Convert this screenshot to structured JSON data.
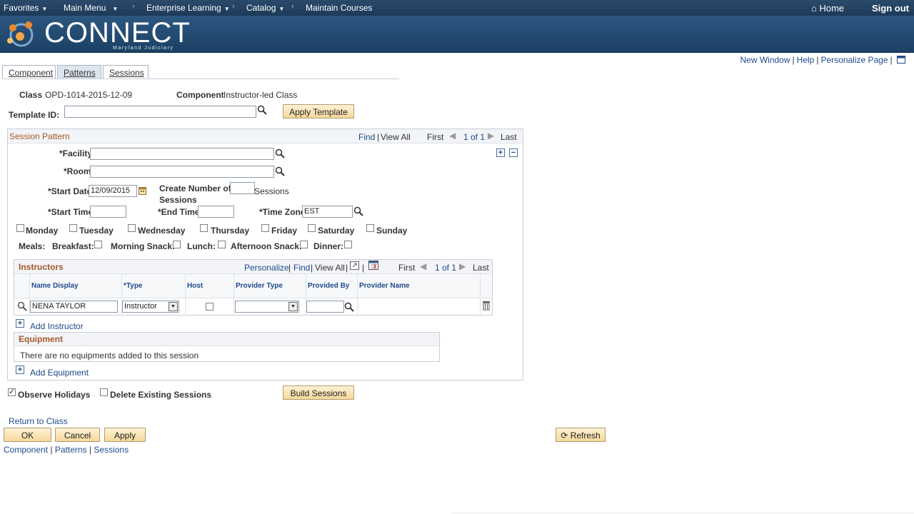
{
  "nav": {
    "favorites": "Favorites",
    "main_menu": "Main Menu",
    "enterprise_learning": "Enterprise Learning",
    "catalog": "Catalog",
    "maintain_courses": "Maintain Courses",
    "home": "Home",
    "sign_out": "Sign out"
  },
  "banner": {
    "logo_text": "CONNECT",
    "logo_sub": "Maryland Judiciary"
  },
  "toplinks": {
    "new_window": "New Window",
    "help": "Help",
    "personalize_page": "Personalize Page"
  },
  "tabs": [
    {
      "label": "Component"
    },
    {
      "label": "Patterns"
    },
    {
      "label": "Sessions"
    }
  ],
  "header": {
    "class_label": "Class",
    "class_value": "OPD-1014-2015-12-09",
    "component_label": "Component",
    "component_value": "Instructor-led Class",
    "template_label": "Template ID:",
    "template_value": "",
    "apply_template": "Apply Template"
  },
  "session_pattern": {
    "title": "Session Pattern",
    "find": "Find",
    "view_all": "View All",
    "first": "First",
    "count": "1 of 1",
    "last": "Last",
    "facility_label": "*Facility",
    "facility_value": "",
    "room_label": "*Room",
    "room_value": "",
    "start_date_label": "*Start Date",
    "start_date_value": "12/09/2015",
    "create_number_label_1": "Create Number of",
    "create_number_label_2": "Sessions",
    "create_number_value": "",
    "sessions_suffix": "Sessions",
    "start_time_label": "*Start Time",
    "start_time_value": "",
    "end_time_label": "*End Time",
    "end_time_value": "",
    "time_zone_label": "*Time Zone",
    "time_zone_value": "EST",
    "days": [
      "Monday",
      "Tuesday",
      "Wednesday",
      "Thursday",
      "Friday",
      "Saturday",
      "Sunday"
    ],
    "meals_label": "Meals:",
    "meals": [
      "Breakfast:",
      "Morning Snack:",
      "Lunch:",
      "Afternoon Snack:",
      "Dinner:"
    ]
  },
  "instructors": {
    "title": "Instructors",
    "personalize": "Personalize",
    "find": "Find",
    "view_all": "View All",
    "first": "First",
    "count": "1 of 1",
    "last": "Last",
    "columns": [
      "Name Display",
      "*Type",
      "Host",
      "Provider Type",
      "Provided By",
      "Provider Name"
    ],
    "row": {
      "name": "NENA TAYLOR",
      "type": "Instructor",
      "host": false,
      "provider_type": "",
      "provided_by": "",
      "provider_name": ""
    },
    "add_label": "Add Instructor"
  },
  "equipment": {
    "title": "Equipment",
    "empty": "There are no equipments added to this session",
    "add_label": "Add Equipment"
  },
  "footer": {
    "observe_holidays": "Observe Holidays",
    "observe_holidays_checked": true,
    "delete_existing": "Delete Existing Sessions",
    "delete_existing_checked": false,
    "build_sessions": "Build Sessions",
    "return_to_class": "Return to Class",
    "ok": "OK",
    "cancel": "Cancel",
    "apply": "Apply",
    "refresh": "Refresh",
    "bottom_links": [
      "Component",
      "Patterns",
      "Sessions"
    ]
  }
}
